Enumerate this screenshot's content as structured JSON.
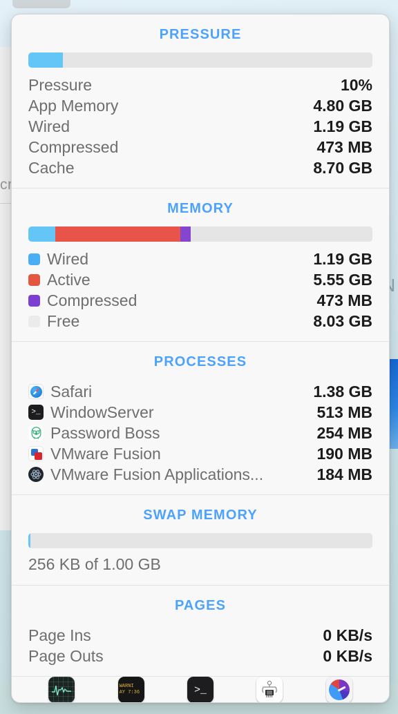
{
  "panel": {
    "accent_color": "#4da2fb",
    "sections": [
      {
        "id": "pressure",
        "title": "PRESSURE",
        "bar": {
          "name": "pressure-bar",
          "segments": [
            {
              "name": "used",
              "percent": 10,
              "color": "#63c6f7"
            },
            {
              "name": "track",
              "percent": 90,
              "color": "#e5e5e5"
            }
          ]
        },
        "rows": [
          {
            "label": "Pressure",
            "value": "10%"
          },
          {
            "label": "App Memory",
            "value": "4.80 GB"
          },
          {
            "label": "Wired",
            "value": "1.19 GB"
          },
          {
            "label": "Compressed",
            "value": "473 MB"
          },
          {
            "label": "Cache",
            "value": "8.70 GB"
          }
        ]
      },
      {
        "id": "memory",
        "title": "MEMORY",
        "bar": {
          "name": "memory-bar",
          "segments": [
            {
              "name": "wired",
              "percent": 7.8,
              "color": "#63c6f7"
            },
            {
              "name": "active",
              "percent": 36.3,
              "color": "#e8534a"
            },
            {
              "name": "compressed",
              "percent": 3.1,
              "color": "#8445cf"
            },
            {
              "name": "free",
              "percent": 52.8,
              "color": "#e5e5e5"
            }
          ]
        },
        "rows": [
          {
            "label": "Wired",
            "value": "1.19 GB",
            "swatch": "#4aaef4"
          },
          {
            "label": "Active",
            "value": "5.55 GB",
            "swatch": "#e4563e"
          },
          {
            "label": "Compressed",
            "value": "473 MB",
            "swatch": "#7b3fd1"
          },
          {
            "label": "Free",
            "value": "8.03 GB",
            "swatch": "#ebebeb"
          }
        ]
      },
      {
        "id": "processes",
        "title": "PROCESSES",
        "rows": [
          {
            "label": "Safari",
            "value": "1.38 GB",
            "icon": "safari-icon"
          },
          {
            "label": "WindowServer",
            "value": "513 MB",
            "icon": "terminal-icon"
          },
          {
            "label": "Password Boss",
            "value": "254 MB",
            "icon": "owl-icon"
          },
          {
            "label": "VMware Fusion",
            "value": "190 MB",
            "icon": "vmware-icon"
          },
          {
            "label": "VMware Fusion Applications...",
            "value": "184 MB",
            "icon": "electron-icon"
          }
        ]
      },
      {
        "id": "swap",
        "title": "SWAP MEMORY",
        "bar": {
          "name": "swap-bar",
          "segments": [
            {
              "name": "used",
              "percent": 0.6,
              "color": "#63c6f7"
            },
            {
              "name": "track",
              "percent": 99.4,
              "color": "#e5e5e5"
            }
          ]
        },
        "caption": "256 KB of 1.00 GB"
      },
      {
        "id": "pages",
        "title": "PAGES",
        "rows": [
          {
            "label": "Page Ins",
            "value": "0 KB/s"
          },
          {
            "label": "Page Outs",
            "value": "0 KB/s"
          }
        ]
      }
    ],
    "toolbar": [
      {
        "name": "activity-monitor-icon",
        "kind": "activity",
        "label": "Activity Monitor"
      },
      {
        "name": "console-icon",
        "kind": "console",
        "label": "Console",
        "line1": "WARNI",
        "line2": "AY 7:36"
      },
      {
        "name": "terminal-icon",
        "kind": "terminal",
        "label": "Terminal",
        "glyph": ">_"
      },
      {
        "name": "hardware-icon",
        "kind": "hardware",
        "label": "System Information"
      },
      {
        "name": "gauge-icon",
        "kind": "gauge",
        "label": "Performance Gauge"
      }
    ]
  },
  "desktop": {
    "window_fragment_text": "cr",
    "right_letter": "N"
  }
}
